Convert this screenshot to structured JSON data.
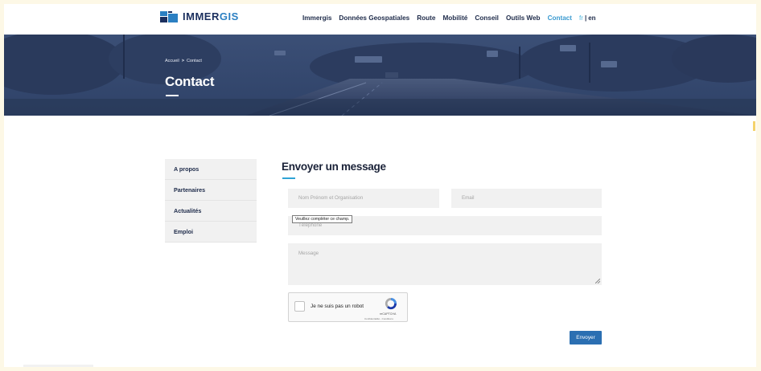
{
  "brand": {
    "name_part1": "IMMER",
    "name_part2": "GIS"
  },
  "nav": {
    "items": [
      "Immergis",
      "Données Geospatiales",
      "Route",
      "Mobilité",
      "Conseil",
      "Outils Web",
      "Contact"
    ],
    "active": "Contact",
    "lang_fr": "fr",
    "lang_sep": "|",
    "lang_en": "en"
  },
  "hero": {
    "breadcrumb_home": "Accueil",
    "breadcrumb_sep": ">",
    "breadcrumb_current": "Contact",
    "title": "Contact"
  },
  "sidebar": {
    "items": [
      {
        "label": "A propos"
      },
      {
        "label": "Partenaires"
      },
      {
        "label": "Actualités"
      },
      {
        "label": "Emploi"
      }
    ]
  },
  "form": {
    "title": "Envoyer un message",
    "name_placeholder": "Nom Prénom et Organisation",
    "email_placeholder": "Email",
    "phone_placeholder": "Téléphone",
    "message_placeholder": "Message",
    "validation_tooltip": "Veuillez compléter ce champ.",
    "captcha_label": "Je ne suis pas un robot",
    "captcha_brand": "reCAPTCHA",
    "captcha_terms": "Confidentialité - Conditions",
    "submit_label": "Envoyer"
  },
  "colors": {
    "brand_dark": "#1b2f5e",
    "brand_accent": "#2b7fc2",
    "nav_active": "#3a9ad0",
    "submit_bg": "#2b6fb2",
    "field_bg": "#f1f1f1"
  }
}
